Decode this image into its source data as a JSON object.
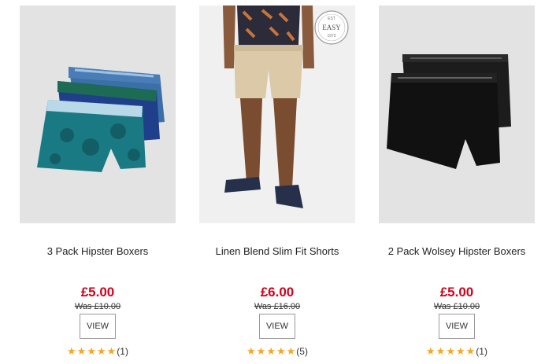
{
  "colors": {
    "price": "#d0021b",
    "star": "#f5a623",
    "image_bg": "#e3e3e3"
  },
  "products": [
    {
      "name": "3 Pack Hipster Boxers",
      "price": "£5.00",
      "was": "Was £10.00",
      "view_label": "VIEW",
      "stars": "★★★★★",
      "review_count": "(1)",
      "rating": 5
    },
    {
      "name": "Linen Blend Slim Fit Shorts",
      "price": "£6.00",
      "was": "Was £16.00",
      "view_label": "VIEW",
      "stars": "★★★★★",
      "review_count": "(5)",
      "rating": 5,
      "badge": {
        "top": "EST",
        "middle": "EASY",
        "bottom": "1973"
      }
    },
    {
      "name": "2 Pack Wolsey Hipster Boxers",
      "price": "£5.00",
      "was": "Was £10.00",
      "view_label": "VIEW",
      "stars": "★★★★★",
      "review_count": "(1)",
      "rating": 5
    }
  ]
}
